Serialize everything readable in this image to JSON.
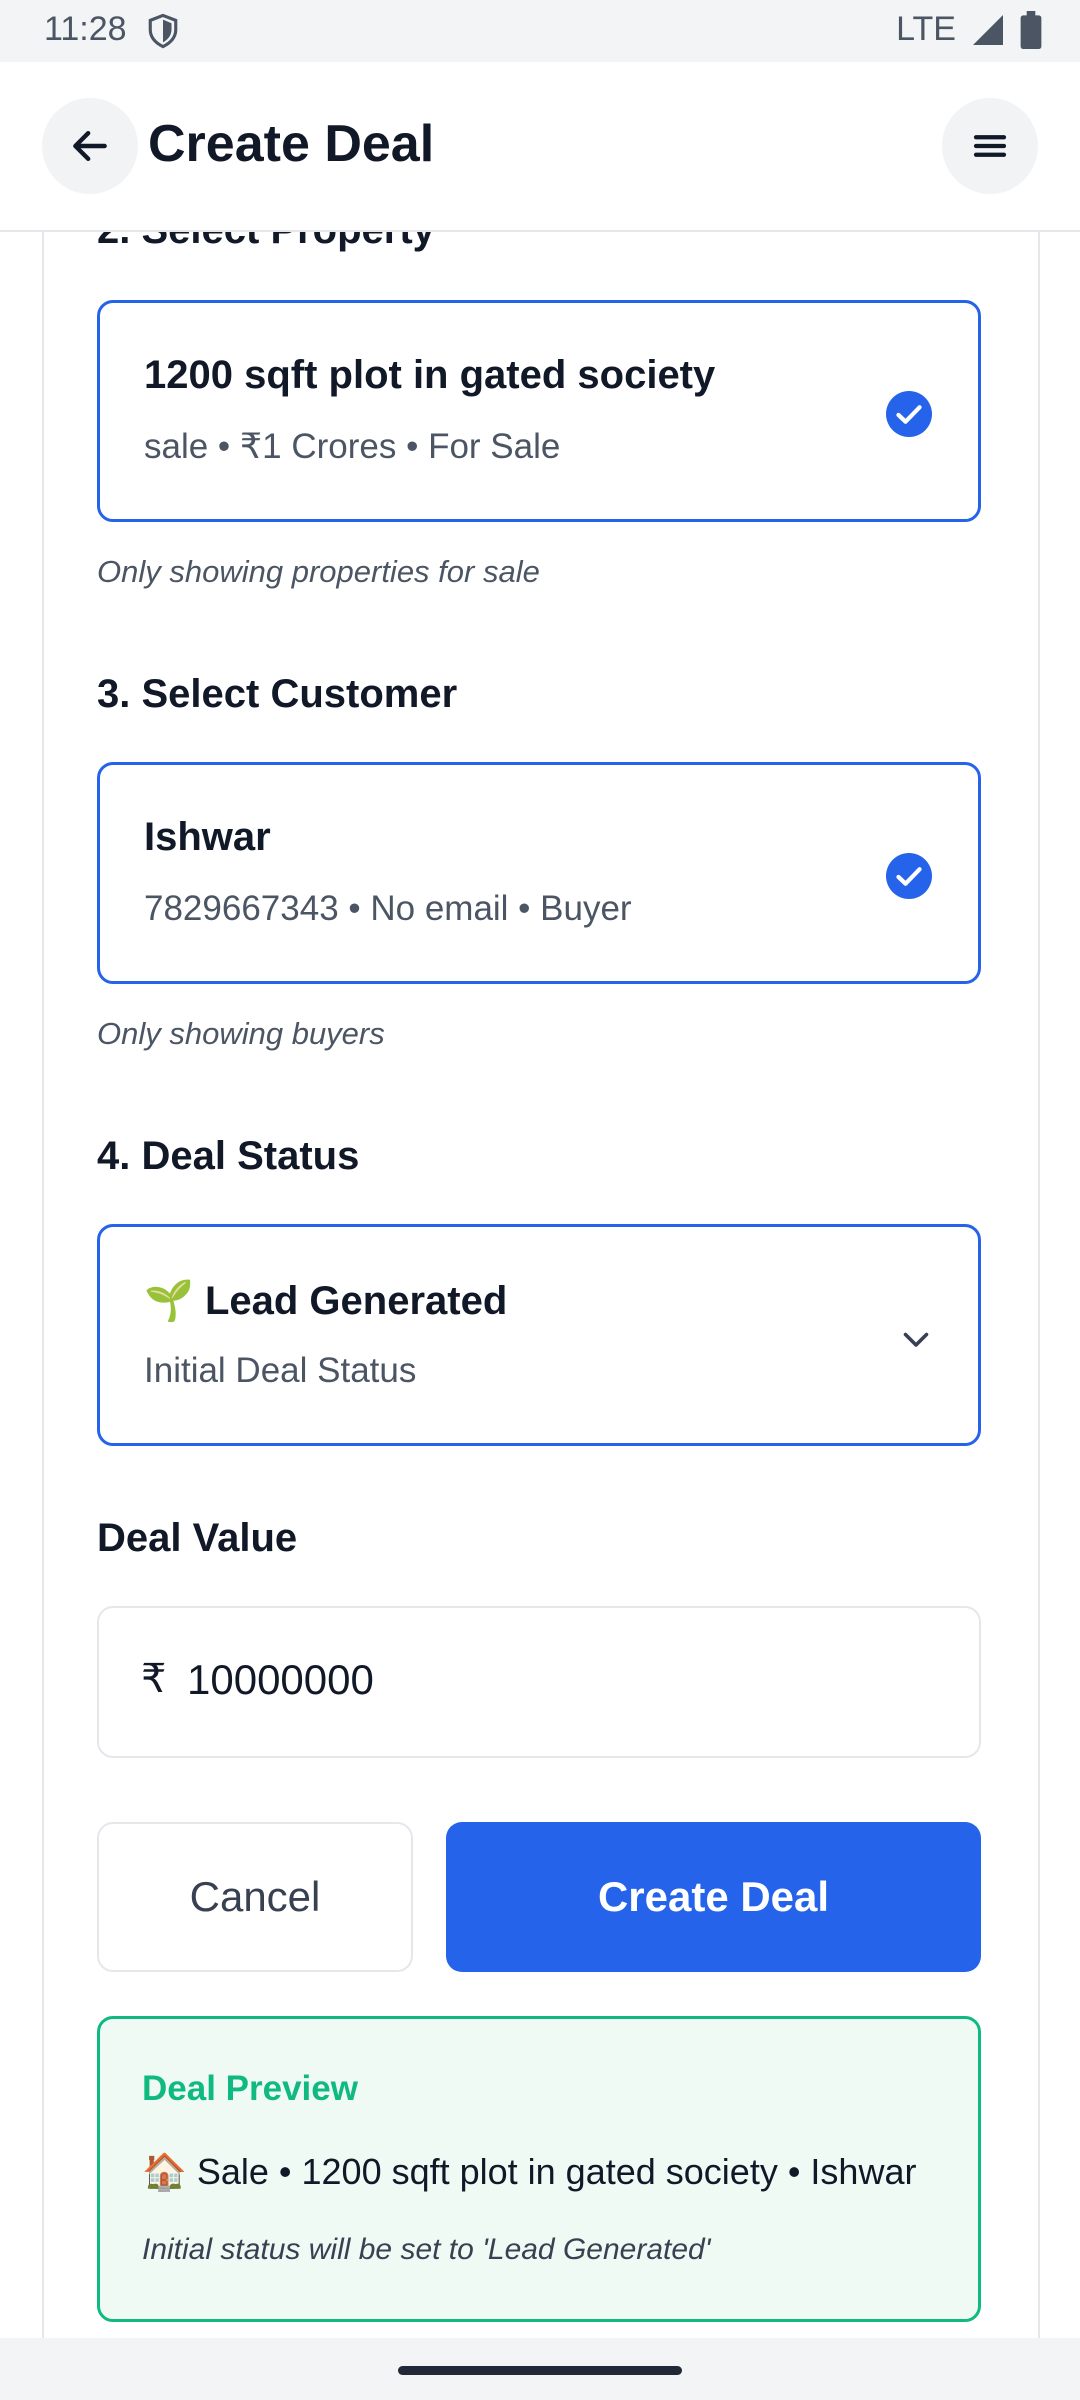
{
  "status_bar": {
    "time": "11:28",
    "network": "LTE"
  },
  "header": {
    "title": "Create Deal"
  },
  "sections": {
    "property_label": "2. Select Property",
    "customer_label": "3. Select Customer",
    "status_label": "4. Deal Status",
    "value_label": "Deal Value"
  },
  "property": {
    "title": "1200 sqft plot in gated society",
    "subtitle": "sale • ₹1 Crores • For Sale",
    "helper": "Only showing properties for sale"
  },
  "customer": {
    "name": "Ishwar",
    "subtitle": "7829667343 • No email • Buyer",
    "helper": "Only showing buyers"
  },
  "deal_status": {
    "emoji": "🌱",
    "selected": "Lead Generated",
    "subtitle": "Initial Deal Status"
  },
  "deal_value": {
    "currency": "₹",
    "value": "10000000"
  },
  "actions": {
    "cancel": "Cancel",
    "create": "Create Deal"
  },
  "preview": {
    "title": "Deal Preview",
    "emoji": "🏠",
    "line": "Sale • 1200 sqft plot in gated society • Ishwar",
    "note": "Initial status will be set to 'Lead Generated'"
  },
  "colors": {
    "accent": "#2563eb",
    "success": "#10b981",
    "preview_bg": "#effaf5"
  }
}
